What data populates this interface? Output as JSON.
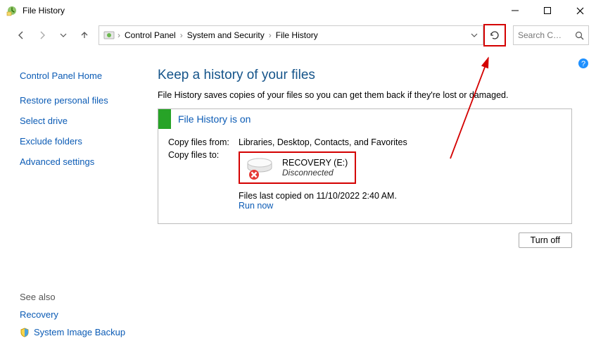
{
  "window": {
    "title": "File History"
  },
  "breadcrumb": {
    "root": "Control Panel",
    "mid": "System and Security",
    "leaf": "File History"
  },
  "search": {
    "placeholder": "Search C…"
  },
  "sidebar": {
    "home": "Control Panel Home",
    "items": [
      "Restore personal files",
      "Select drive",
      "Exclude folders",
      "Advanced settings"
    ],
    "seealso_label": "See also",
    "seealso": {
      "recovery": "Recovery",
      "sib": "System Image Backup"
    }
  },
  "main": {
    "heading": "Keep a history of your files",
    "subtext": "File History saves copies of your files so you can get them back if they're lost or damaged.",
    "status": "File History is on",
    "copy_from_label": "Copy files from:",
    "copy_from_value": "Libraries, Desktop, Contacts, and Favorites",
    "copy_to_label": "Copy files to:",
    "drive_name": "RECOVERY (E:)",
    "drive_status": "Disconnected",
    "last_copied_prefix": "Files last copied on ",
    "last_copied_time": "11/10/2022 2:40 AM.",
    "run_now": "Run now",
    "turn_off": "Turn off"
  }
}
